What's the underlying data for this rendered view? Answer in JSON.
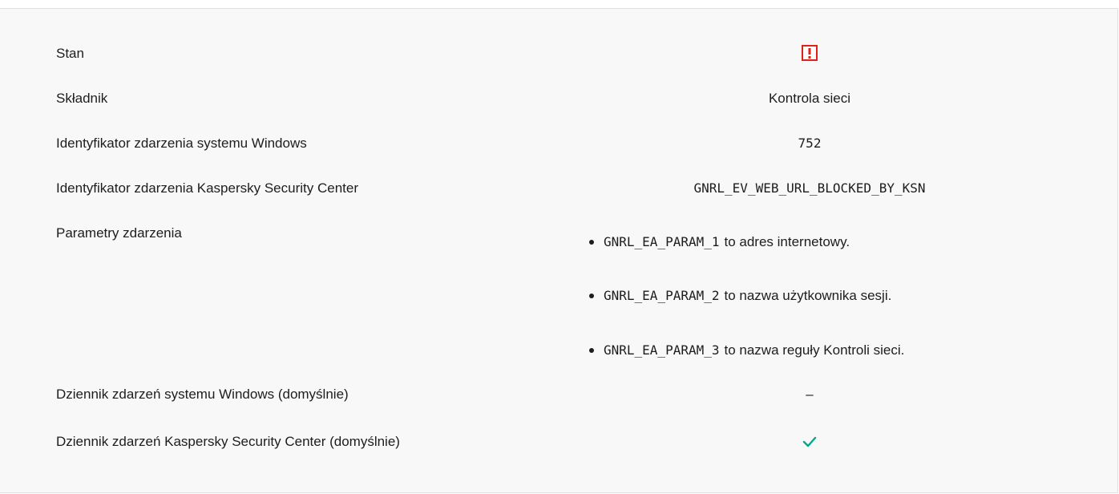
{
  "rows": {
    "status": {
      "label": "Stan",
      "icon": "warning-icon",
      "icon_color": "#e0201b"
    },
    "component": {
      "label": "Składnik",
      "value": "Kontrola sieci"
    },
    "windows_event_id": {
      "label": "Identyfikator zdarzenia systemu Windows",
      "value": "752"
    },
    "ksc_event_id": {
      "label": "Identyfikator zdarzenia Kaspersky Security Center",
      "value": "GNRL_EV_WEB_URL_BLOCKED_BY_KSN"
    },
    "event_parameters": {
      "label": "Parametry zdarzenia",
      "items": [
        {
          "code": "GNRL_EA_PARAM_1",
          "text": "to adres internetowy."
        },
        {
          "code": "GNRL_EA_PARAM_2",
          "text": "to nazwa użytkownika sesji."
        },
        {
          "code": "GNRL_EA_PARAM_3",
          "text": "to nazwa reguły Kontroli sieci."
        }
      ]
    },
    "windows_log": {
      "label": "Dziennik zdarzeń systemu Windows (domyślnie)",
      "value": "–"
    },
    "ksc_log": {
      "label": "Dziennik zdarzeń Kaspersky Security Center (domyślnie)",
      "icon": "checkmark-icon",
      "icon_color": "#00a88e"
    }
  }
}
